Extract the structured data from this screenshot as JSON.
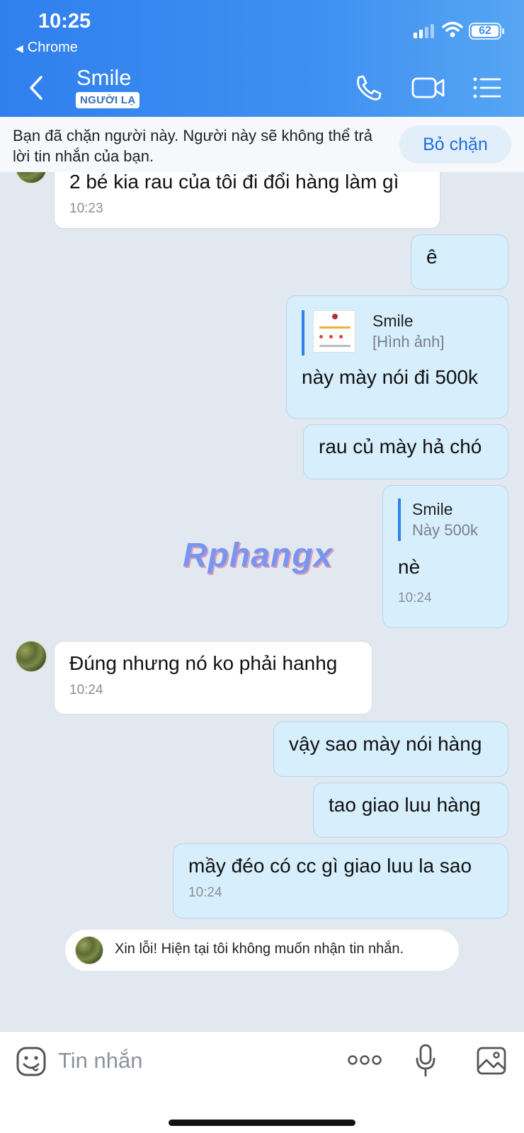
{
  "status_bar": {
    "time": "10:25",
    "back_app": "Chrome",
    "battery": "62"
  },
  "header": {
    "contact_name": "Smile",
    "stranger_badge": "NGƯỜI LẠ",
    "icons": [
      "back-icon",
      "phone-icon",
      "video-icon",
      "menu-list-icon"
    ]
  },
  "banner": {
    "text": "Bạn đã chặn người này. Người này sẽ không thể trả lời tin nhắn của bạn.",
    "unblock_label": "Bỏ chặn"
  },
  "messages": [
    {
      "side": "in",
      "text": "2 bé kia rau của tôi đi đổi hàng làm gì",
      "time": "10:23"
    },
    {
      "side": "out",
      "text": "ê"
    },
    {
      "side": "out",
      "quote": {
        "name": "Smile",
        "sub": "[Hình ảnh]",
        "has_image": true
      },
      "text": "này mày nói đi 500k"
    },
    {
      "side": "out",
      "text": "rau củ mày hả chó"
    },
    {
      "side": "out",
      "quote": {
        "name": "Smile",
        "sub": "Này 500k"
      },
      "text": "nè",
      "time": "10:24"
    },
    {
      "side": "in",
      "text": "Đúng nhưng nó ko phải hanhg",
      "time": "10:24"
    },
    {
      "side": "out",
      "text": "vậy sao mày nói hàng"
    },
    {
      "side": "out",
      "text": "tao giao luu hàng"
    },
    {
      "side": "out",
      "text": "mầy đéo có cc gì giao luu la sao",
      "time": "10:24"
    }
  ],
  "watermark": "Rphangx",
  "system_note": "Xin lỗi! Hiện tại tôi không muốn nhận tin nhắn.",
  "input_bar": {
    "placeholder": "Tin nhắn",
    "icons": [
      "emoji-icon",
      "more-icon",
      "microphone-icon",
      "image-icon"
    ]
  },
  "colors": {
    "header": "#3f8ff2",
    "outgoing_bubble": "#d7eefd",
    "incoming_bubble": "#ffffff",
    "chat_bg": "#e2e8ef",
    "accent": "#2f80ed"
  }
}
